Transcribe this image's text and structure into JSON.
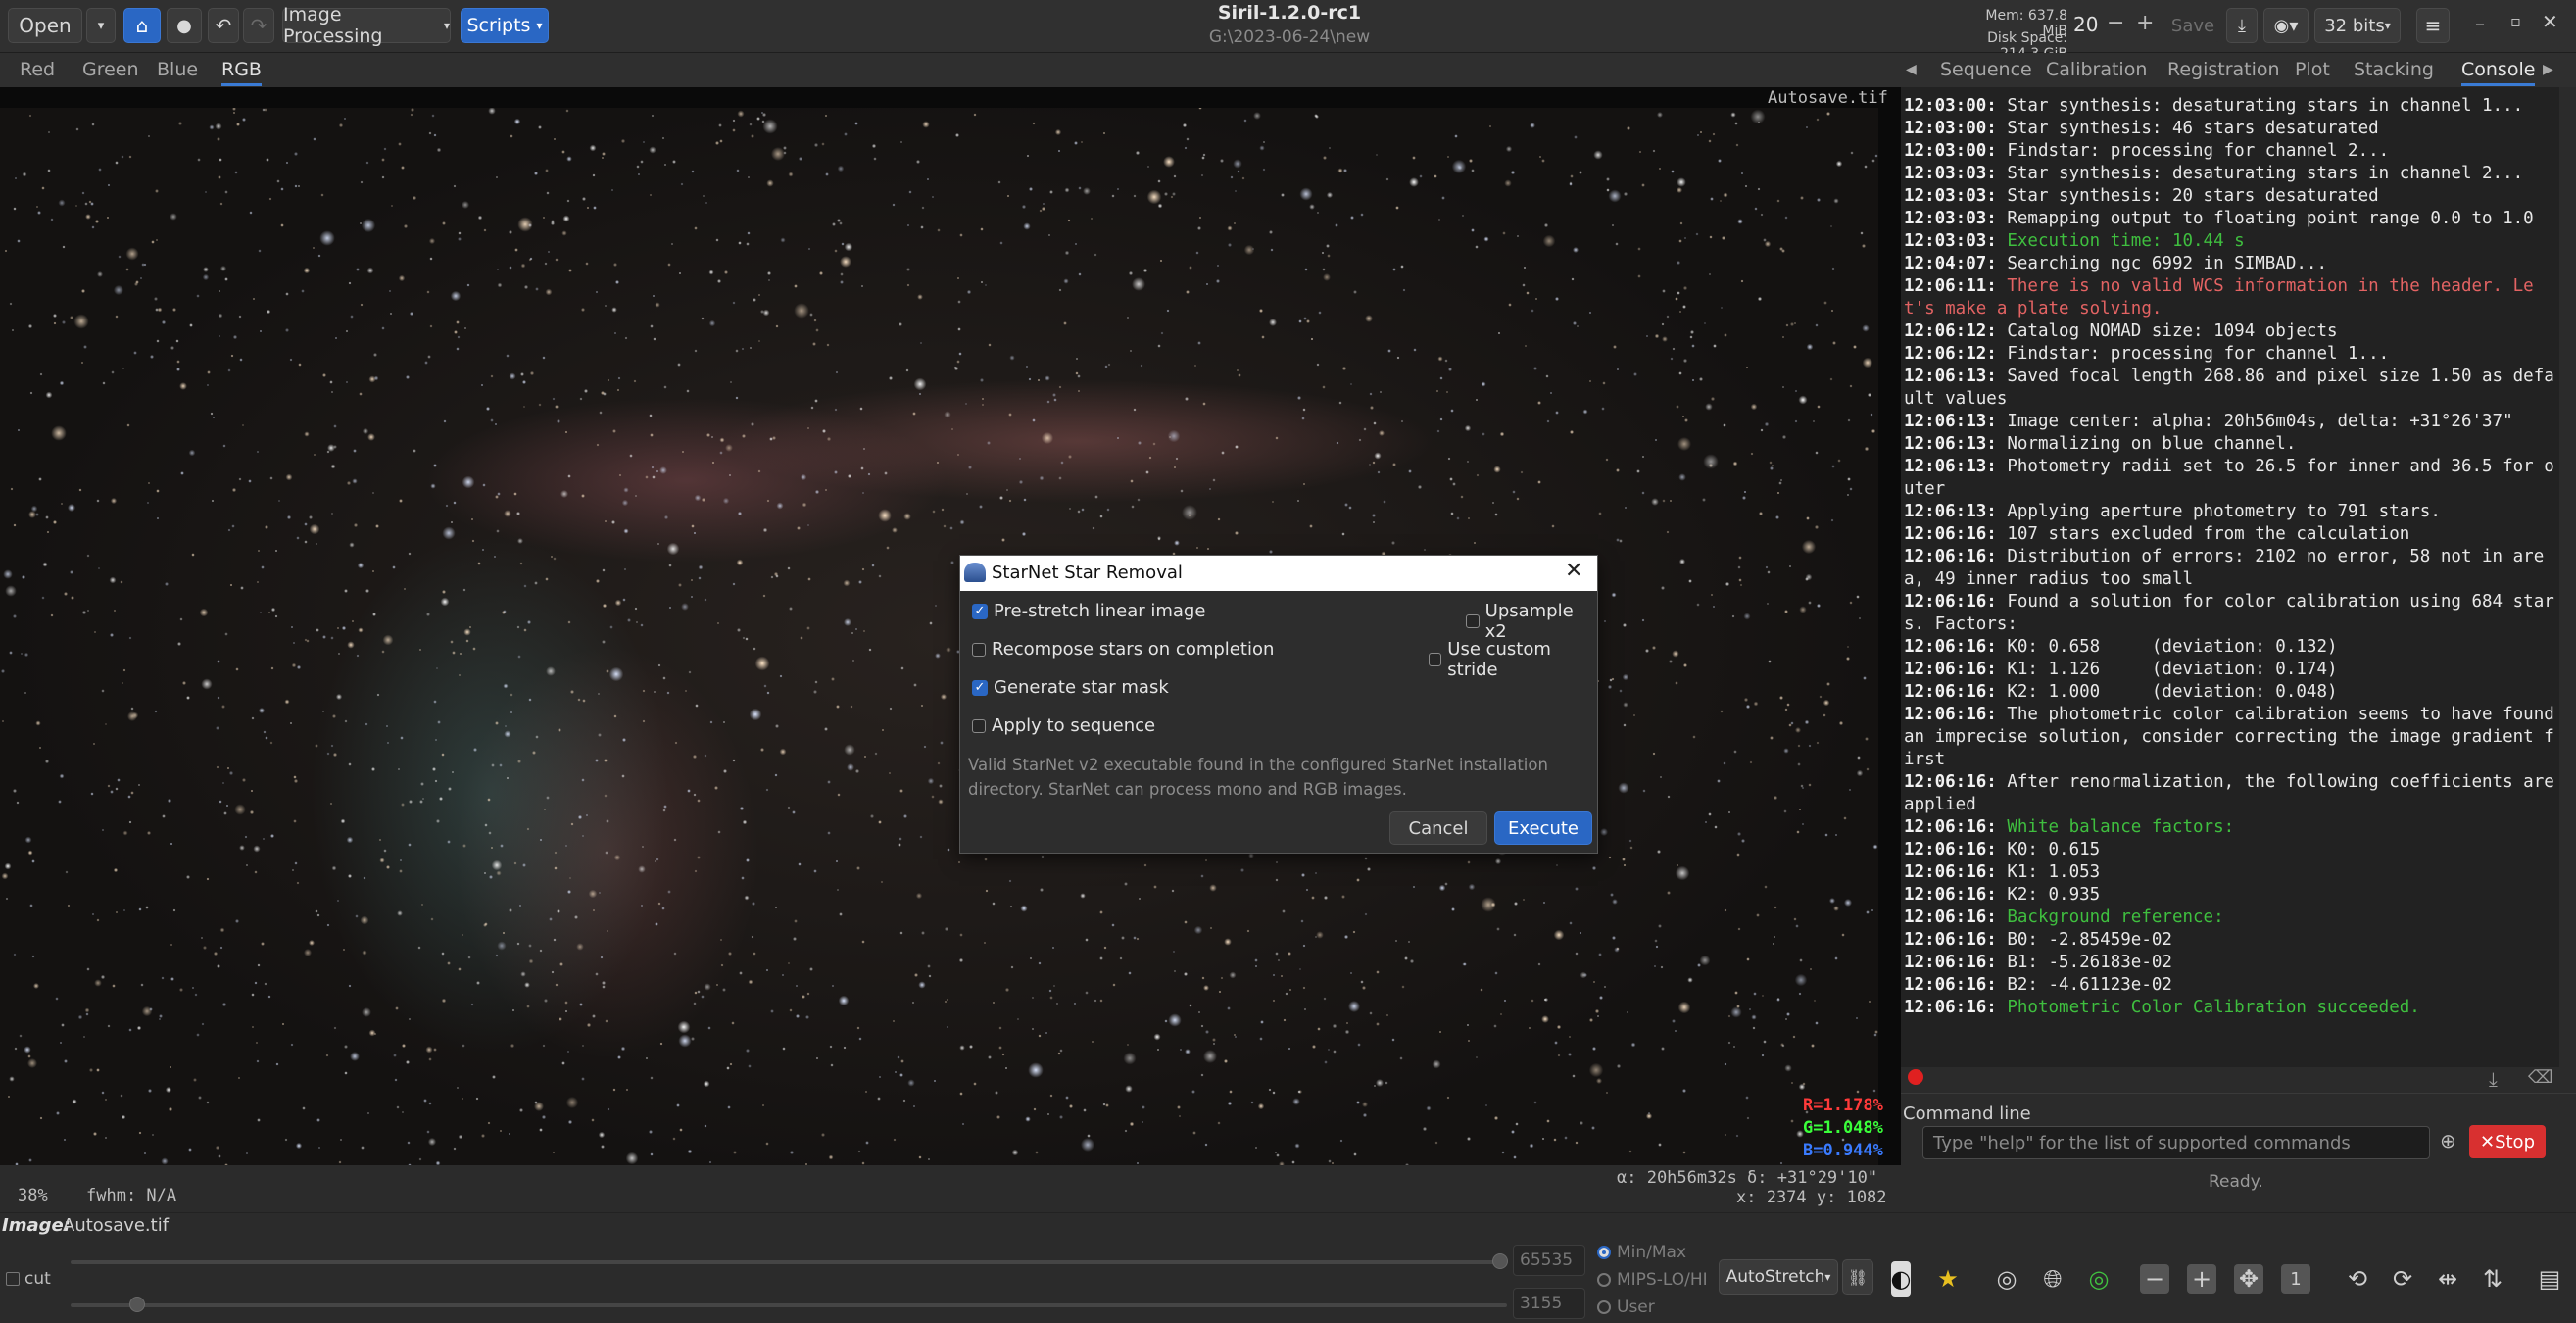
{
  "app": {
    "title": "Siril-1.2.0-rc1",
    "path": "G:\\2023-06-24\\new",
    "open_label": "Open",
    "image_processing_label": "Image Processing",
    "scripts_label": "Scripts",
    "mem": "Mem: 637.8 MiB",
    "disk": "Disk Space: 214.3 GiB",
    "threads_value": "20",
    "save_label": "Save",
    "bits_label": "32 bits"
  },
  "channel_tabs": [
    "Red",
    "Green",
    "Blue",
    "RGB"
  ],
  "image": {
    "autosave_label": "Autosave.tif",
    "readout_r": "R=1.178%",
    "readout_g": "G=1.048%",
    "readout_b": "B=0.944%",
    "zoom": "38%",
    "fwhm": "fwhm: N/A",
    "alpha_delta": "α: 20h56m32s δ: +31°29'10\"",
    "xy": "x: 2374 y: 1082"
  },
  "right_tabs": [
    "Sequence",
    "Calibration",
    "Registration",
    "Plot",
    "Stacking",
    "Console"
  ],
  "console": [
    {
      "ts": "12:03:00:",
      "text": " Star synthesis: desaturating stars in channel 1...",
      "c": ""
    },
    {
      "ts": "12:03:00:",
      "text": " Star synthesis: 46 stars desaturated",
      "c": ""
    },
    {
      "ts": "12:03:00:",
      "text": " Findstar: processing for channel 2...",
      "c": ""
    },
    {
      "ts": "12:03:03:",
      "text": " Star synthesis: desaturating stars in channel 2...",
      "c": ""
    },
    {
      "ts": "12:03:03:",
      "text": " Star synthesis: 20 stars desaturated",
      "c": ""
    },
    {
      "ts": "12:03:03:",
      "text": " Remapping output to floating point range 0.0 to 1.0",
      "c": ""
    },
    {
      "ts": "12:03:03:",
      "text": " Execution time: 10.44 s",
      "c": "green"
    },
    {
      "ts": "12:04:07:",
      "text": " Searching ngc 6992 in SIMBAD...",
      "c": ""
    },
    {
      "ts": "12:06:11:",
      "text": " There is no valid WCS information in the header. Let's make a plate solving.",
      "c": "red"
    },
    {
      "ts": "12:06:12:",
      "text": " Catalog NOMAD size: 1094 objects",
      "c": ""
    },
    {
      "ts": "12:06:12:",
      "text": " Findstar: processing for channel 1...",
      "c": ""
    },
    {
      "ts": "12:06:13:",
      "text": " Saved focal length 268.86 and pixel size 1.50 as default values",
      "c": ""
    },
    {
      "ts": "12:06:13:",
      "text": " Image center: alpha: 20h56m04s, delta: +31°26'37\"",
      "c": ""
    },
    {
      "ts": "12:06:13:",
      "text": " Normalizing on blue channel.",
      "c": ""
    },
    {
      "ts": "12:06:13:",
      "text": " Photometry radii set to 26.5 for inner and 36.5 for outer",
      "c": ""
    },
    {
      "ts": "12:06:13:",
      "text": " Applying aperture photometry to 791 stars.",
      "c": ""
    },
    {
      "ts": "12:06:16:",
      "text": " 107 stars excluded from the calculation",
      "c": ""
    },
    {
      "ts": "12:06:16:",
      "text": " Distribution of errors: 2102 no error, 58 not in area, 49 inner radius too small",
      "c": ""
    },
    {
      "ts": "12:06:16:",
      "text": " Found a solution for color calibration using 684 stars. Factors:",
      "c": ""
    },
    {
      "ts": "12:06:16:",
      "text": " K0: 0.658     (deviation: 0.132)",
      "c": ""
    },
    {
      "ts": "12:06:16:",
      "text": " K1: 1.126     (deviation: 0.174)",
      "c": ""
    },
    {
      "ts": "12:06:16:",
      "text": " K2: 1.000     (deviation: 0.048)",
      "c": ""
    },
    {
      "ts": "12:06:16:",
      "text": " The photometric color calibration seems to have found an imprecise solution, consider correcting the image gradient first",
      "c": ""
    },
    {
      "ts": "12:06:16:",
      "text": " After renormalization, the following coefficients are applied",
      "c": ""
    },
    {
      "ts": "12:06:16:",
      "text": " White balance factors:",
      "c": "green"
    },
    {
      "ts": "12:06:16:",
      "text": " K0: 0.615",
      "c": ""
    },
    {
      "ts": "12:06:16:",
      "text": " K1: 1.053",
      "c": ""
    },
    {
      "ts": "12:06:16:",
      "text": " K2: 0.935",
      "c": ""
    },
    {
      "ts": "12:06:16:",
      "text": " Background reference:",
      "c": "green"
    },
    {
      "ts": "12:06:16:",
      "text": " B0: -2.85459e-02",
      "c": ""
    },
    {
      "ts": "12:06:16:",
      "text": " B1: -5.26183e-02",
      "c": ""
    },
    {
      "ts": "12:06:16:",
      "text": " B2: -4.61123e-02",
      "c": ""
    },
    {
      "ts": "12:06:16:",
      "text": " Photometric Color Calibration succeeded.",
      "c": "green"
    }
  ],
  "command": {
    "label": "Command line",
    "placeholder": "Type \"help\" for the list of supported commands",
    "stop_label": "Stop",
    "status": "Ready."
  },
  "bottom": {
    "image_label": "Image:",
    "image_name": "Autosave.tif",
    "cut_label": "cut",
    "high_value": "65535",
    "low_value": "3155",
    "radio_minmax": "Min/Max",
    "radio_mips": "MIPS-LO/HI",
    "radio_user": "User",
    "stretch_label": "AutoStretch"
  },
  "dialog": {
    "title": "StarNet Star Removal",
    "prestretch": "Pre-stretch linear image",
    "upsample": "Upsample x2",
    "recompose": "Recompose stars on completion",
    "custom_stride": "Use custom stride",
    "star_mask": "Generate star mask",
    "apply_seq": "Apply to sequence",
    "info": "Valid StarNet v2 executable found in the configured StarNet installation directory. StarNet can process mono and RGB images.",
    "cancel_label": "Cancel",
    "execute_label": "Execute"
  }
}
